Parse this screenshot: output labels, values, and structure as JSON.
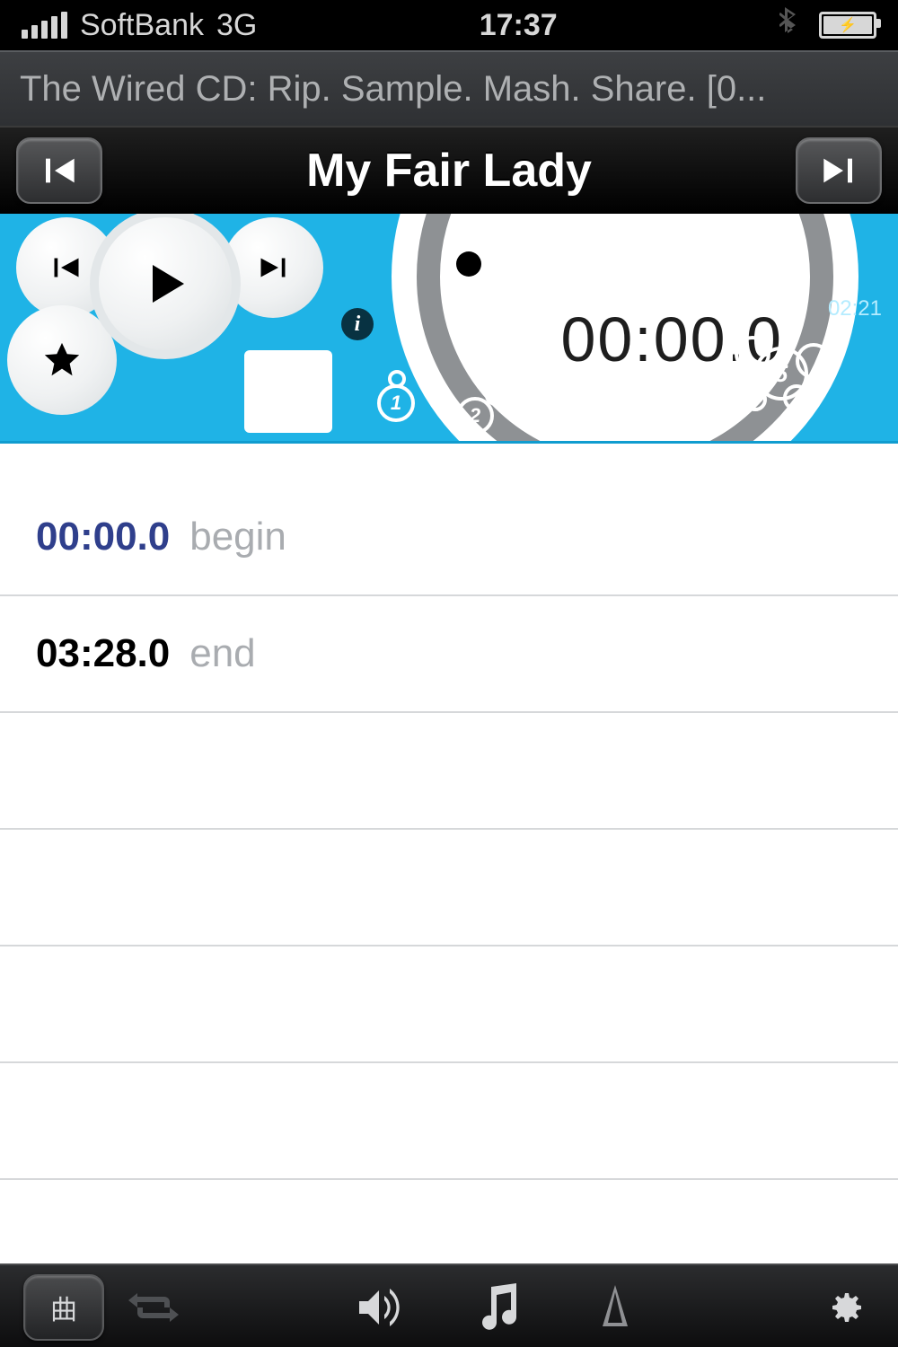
{
  "status": {
    "carrier": "SoftBank",
    "network": "3G",
    "time": "17:37"
  },
  "header": {
    "album": "The Wired CD: Rip. Sample. Mash. Share. [0...",
    "track_title": "My Fair Lady"
  },
  "player": {
    "timer": "00:00.0",
    "duration": "02:21",
    "markers": [
      "1",
      "2",
      "3",
      "4",
      "5"
    ]
  },
  "list": {
    "rows": [
      {
        "time": "00:00.0",
        "label": "begin",
        "kind": "begin"
      },
      {
        "time": "03:28.0",
        "label": "end",
        "kind": "end"
      }
    ]
  },
  "toolbar": {
    "tracks_label": "曲"
  }
}
